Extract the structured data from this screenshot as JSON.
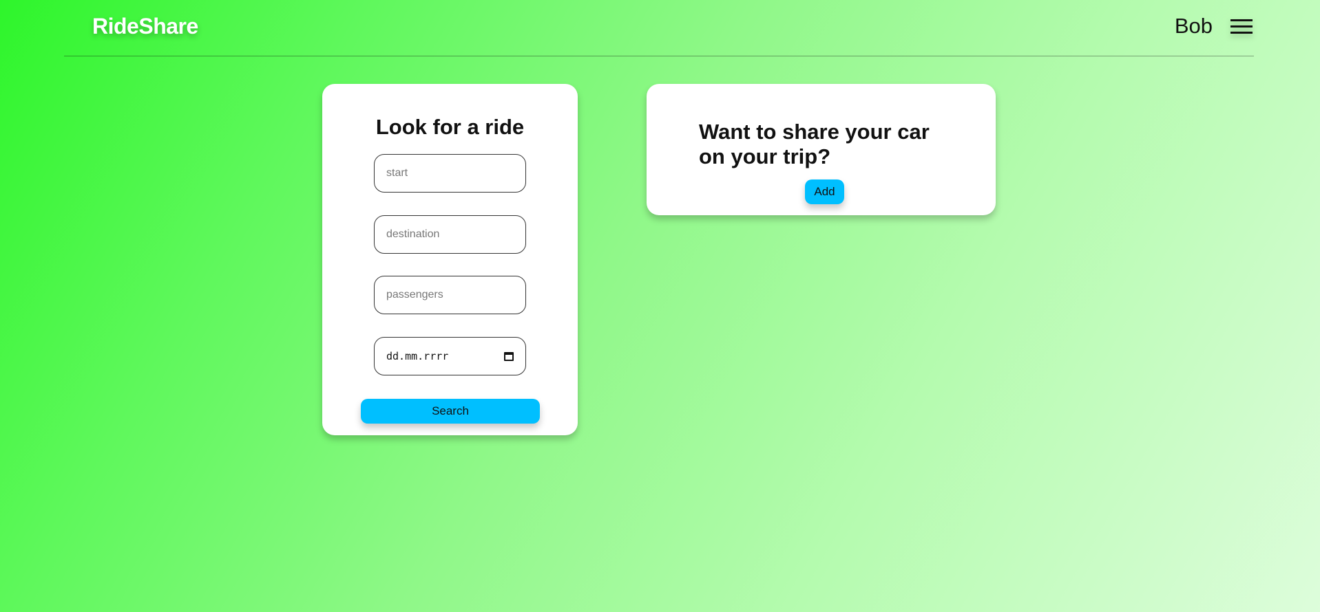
{
  "header": {
    "logo": "RideShare",
    "user_name": "Bob",
    "menu_icon": "hamburger-menu-icon"
  },
  "search": {
    "title": "Look for a ride",
    "start_placeholder": "start",
    "destination_placeholder": "destination",
    "passengers_placeholder": "passengers",
    "date_placeholder": "dd.mm.rrrr",
    "calendar_icon": "calendar-icon",
    "button_label": "Search"
  },
  "share": {
    "title": "Want to share your car on your trip?",
    "button_label": "Add"
  },
  "colors": {
    "accent_button": "#00bfff",
    "background_start": "#2ef52b",
    "background_end": "#ddfddb",
    "card": "#ffffff"
  }
}
